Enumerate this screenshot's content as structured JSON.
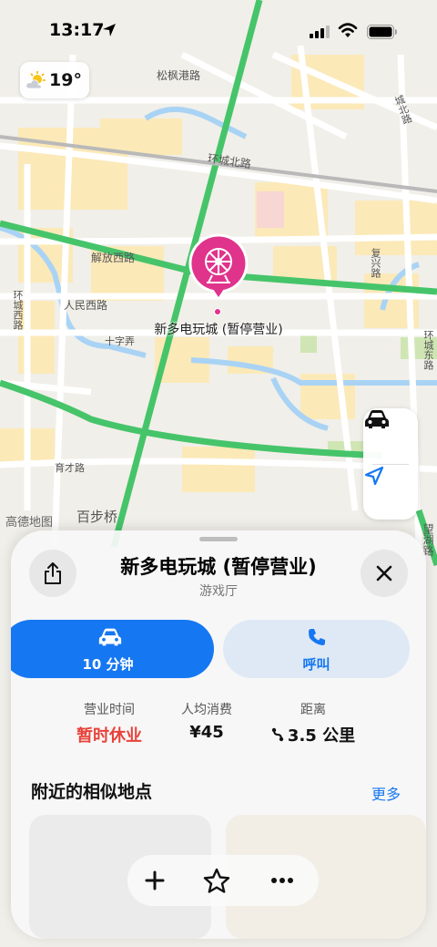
{
  "status_bar": {
    "time": "13:17",
    "icons": [
      "location-arrow-icon",
      "cellular-signal-icon",
      "wifi-icon",
      "battery-icon"
    ]
  },
  "weather": {
    "temperature": "19°",
    "icon": "partly-sunny-icon"
  },
  "map": {
    "labels": {
      "songfeng": "松枫港路",
      "huancheng_north": "环城北路",
      "jiefang_west": "解放西路",
      "renmin_west": "人民西路",
      "shizi": "十字弄",
      "yucai": "育才路",
      "huancheng_west": "环城西路",
      "huancheng_east": "环城东路",
      "chengbei": "城北路",
      "fuxing": "复兴路",
      "wangxiang": "望湖路",
      "baibuqiao": "百步桥"
    },
    "poi_label": "新多电玩城 (暂停营业)",
    "attribution": "高德地图"
  },
  "map_controls": {
    "drive_icon": "car-icon",
    "locate_icon": "location-arrow-icon"
  },
  "sheet": {
    "title": "新多电玩城 (暂停营业)",
    "subtitle": "游戏厅",
    "drive": {
      "label": "10 分钟"
    },
    "call": {
      "label": "呼叫"
    },
    "info": {
      "hours": {
        "key": "营业时间",
        "value": "暂时休业"
      },
      "price": {
        "key": "人均消费",
        "value": "¥45"
      },
      "distance": {
        "key": "距离",
        "value": "3.5 公里"
      }
    },
    "nearby": {
      "title": "附近的相似地点",
      "more": "更多"
    }
  },
  "colors": {
    "accent": "#1677f2",
    "closed_red": "#e8423a",
    "poi_pink": "#e0338c",
    "road_green": "#46c46a"
  }
}
